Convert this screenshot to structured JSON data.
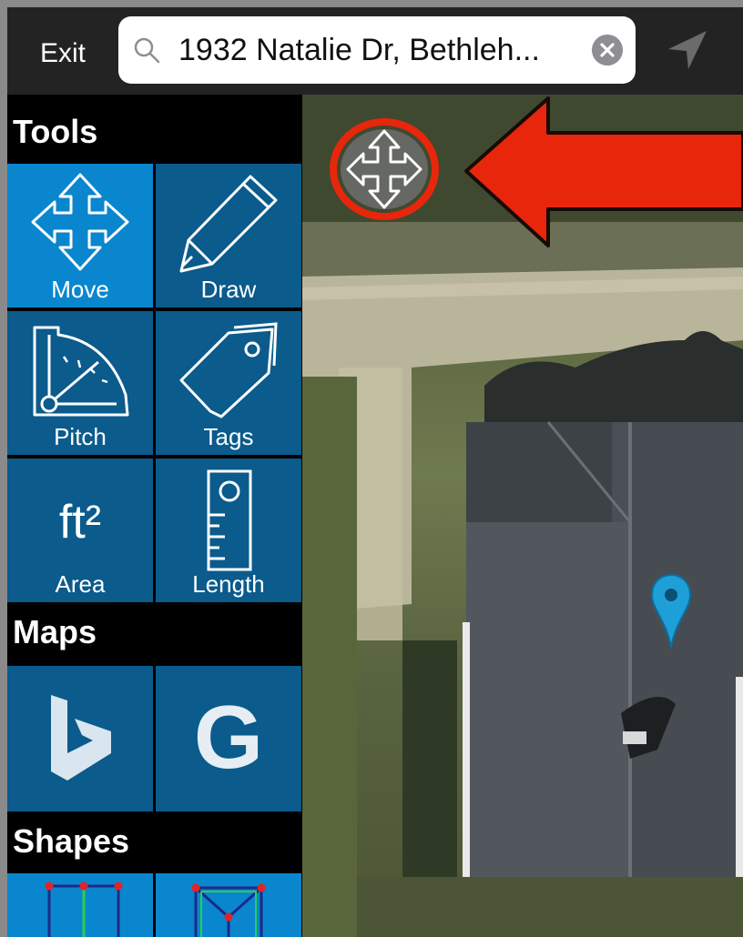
{
  "topbar": {
    "exit_label": "Exit",
    "search_value": "1932 Natalie Dr, Bethleh...",
    "search_icon": "search-icon",
    "clear_icon": "clear-icon",
    "location_icon": "location-arrow-icon"
  },
  "sidebar": {
    "tools_title": "Tools",
    "tools": [
      {
        "label": "Move",
        "icon": "move-icon",
        "active": true
      },
      {
        "label": "Draw",
        "icon": "pencil-icon",
        "active": false
      },
      {
        "label": "Pitch",
        "icon": "protractor-icon",
        "active": false
      },
      {
        "label": "Tags",
        "icon": "tag-icon",
        "active": false
      },
      {
        "label": "Area",
        "icon_text": "ft²",
        "icon": "area-icon",
        "active": false
      },
      {
        "label": "Length",
        "icon": "ruler-icon",
        "active": false
      }
    ],
    "maps_title": "Maps",
    "maps": [
      {
        "icon": "bing-icon"
      },
      {
        "icon": "google-icon",
        "icon_text": "G"
      }
    ],
    "shapes_title": "Shapes",
    "shapes": [
      {
        "icon": "rectangle-shape-icon"
      },
      {
        "icon": "hip-roof-shape-icon"
      }
    ]
  },
  "colors": {
    "active_tile": "#0a86cf",
    "tile": "#0b5b8c",
    "annotation_red": "#e8260c",
    "pin_blue": "#1f9fd8"
  }
}
